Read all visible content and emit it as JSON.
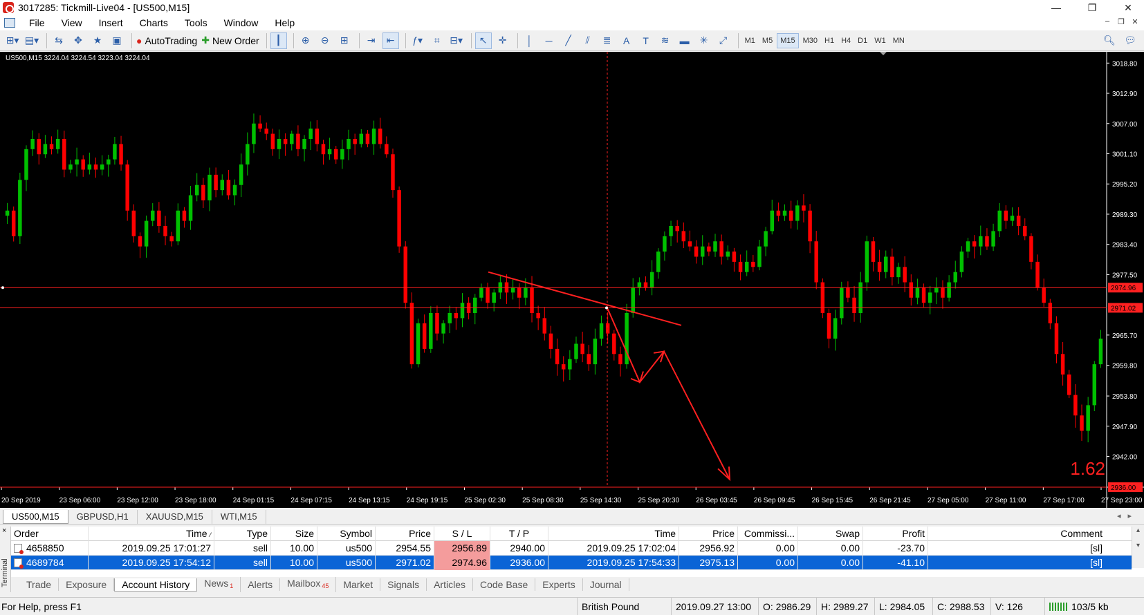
{
  "window": {
    "title": "3017285: Tickmill-Live04 - [US500,M15]",
    "controls": {
      "minimize": "—",
      "restore": "❐",
      "close": "✕"
    }
  },
  "menu": [
    "File",
    "View",
    "Insert",
    "Charts",
    "Tools",
    "Window",
    "Help"
  ],
  "toolbar": {
    "autotrading_label": "AutoTrading",
    "new_order_label": "New Order",
    "timeframes": [
      "M1",
      "M5",
      "M15",
      "M30",
      "H1",
      "H4",
      "D1",
      "W1",
      "MN"
    ],
    "active_timeframe": "M15"
  },
  "chart": {
    "info": "US500,M15  3224.04 3224.54 3223.04 3224.04",
    "ratio_label": "1.62",
    "background_color": "#000000",
    "up_color": "#00c000",
    "down_color": "#ff0000"
  },
  "chart_data": {
    "type": "candlestick",
    "symbol": "US500",
    "timeframe": "M15",
    "y_ticks": [
      "3018.80",
      "3012.90",
      "3007.00",
      "3001.10",
      "2995.20",
      "2989.30",
      "2983.40",
      "2977.50",
      "2965.70",
      "2959.80",
      "2953.80",
      "2947.90",
      "2942.00"
    ],
    "ylim": [
      2936.0,
      3021.0
    ],
    "x_ticks": [
      "20 Sep 2019",
      "23 Sep 06:00",
      "23 Sep 12:00",
      "23 Sep 18:00",
      "24 Sep 01:15",
      "24 Sep 07:15",
      "24 Sep 13:15",
      "24 Sep 19:15",
      "25 Sep 02:30",
      "25 Sep 08:30",
      "25 Sep 14:30",
      "25 Sep 20:30",
      "26 Sep 03:45",
      "26 Sep 09:45",
      "26 Sep 15:45",
      "26 Sep 21:45",
      "27 Sep 05:00",
      "27 Sep 11:00",
      "27 Sep 17:00",
      "27 Sep 23:00"
    ],
    "price_lines": [
      {
        "label": "2974.96",
        "value": 2974.96
      },
      {
        "label": "2971.02",
        "value": 2971.02
      },
      {
        "label": "2936.00",
        "value": 2936.0
      }
    ],
    "close_series": [
      2990,
      2985,
      2996,
      3002,
      3004,
      3001,
      3003,
      3002,
      3004,
      2998,
      2999,
      3000,
      2998,
      2999,
      2998,
      2999,
      3000,
      3003,
      2999,
      2990,
      2985,
      2983,
      2988,
      2990,
      2987,
      2985,
      2984,
      2990,
      2988,
      2993,
      2995,
      2992,
      2997,
      2994,
      2996,
      2993,
      2995,
      2999,
      3003,
      3007,
      3006,
      3005,
      3002,
      3004,
      3003,
      3005,
      3002,
      3004,
      3006,
      3003,
      3001,
      3002,
      3000,
      3002,
      3004,
      3003,
      3005,
      3003,
      3006,
      3003,
      3001,
      2994,
      2983,
      2972,
      2960,
      2968,
      2963,
      2970,
      2966,
      2968,
      2970,
      2969,
      2972,
      2970,
      2973,
      2975,
      2972,
      2974,
      2976,
      2974,
      2975,
      2973,
      2975,
      2970,
      2969,
      2966,
      2963,
      2960,
      2959,
      2961,
      2964,
      2962,
      2960,
      2965,
      2968,
      2966,
      2962,
      2960,
      2970,
      2975,
      2976,
      2975,
      2978,
      2982,
      2985,
      2987,
      2986,
      2984,
      2983,
      2981,
      2983,
      2982,
      2984,
      2981,
      2982,
      2980,
      2978,
      2980,
      2979,
      2983,
      2986,
      2990,
      2989,
      2990,
      2988,
      2991,
      2990,
      2984,
      2976,
      2970,
      2965,
      2969,
      2975,
      2973,
      2970,
      2976,
      2984,
      2980,
      2978,
      2981,
      2977,
      2979,
      2976,
      2973,
      2975,
      2972,
      2974,
      2975,
      2973,
      2976,
      2978,
      2982,
      2984,
      2983,
      2985,
      2983,
      2986,
      2990,
      2988,
      2989,
      2987,
      2985,
      2980,
      2975,
      2972,
      2968,
      2962,
      2958,
      2954,
      2950,
      2947,
      2952,
      2960,
      2965
    ]
  },
  "chart_tabs": [
    "US500,M15",
    "GBPUSD,H1",
    "XAUUSD,M15",
    "WTI,M15"
  ],
  "terminal": {
    "label": "Terminal",
    "close": "×",
    "columns": [
      "Order",
      "Time",
      "Type",
      "Size",
      "Symbol",
      "Price",
      "S / L",
      "T / P",
      "Time",
      "Price",
      "Commissi...",
      "Swap",
      "Profit",
      "Comment"
    ],
    "rows": [
      {
        "order": "4658850",
        "open_time": "2019.09.25 17:01:27",
        "type": "sell",
        "size": "10.00",
        "symbol": "us500",
        "price": "2954.55",
        "sl": "2956.89",
        "tp": "2940.00",
        "close_time": "2019.09.25 17:02:04",
        "close_price": "2956.92",
        "commission": "0.00",
        "swap": "0.00",
        "profit": "-23.70",
        "comment": "[sl]"
      },
      {
        "order": "4689784",
        "open_time": "2019.09.25 17:54:12",
        "type": "sell",
        "size": "10.00",
        "symbol": "us500",
        "price": "2971.02",
        "sl": "2974.96",
        "tp": "2936.00",
        "close_time": "2019.09.25 17:54:33",
        "close_price": "2975.13",
        "commission": "0.00",
        "swap": "0.00",
        "profit": "-41.10",
        "comment": "[sl]"
      }
    ],
    "tabs": [
      {
        "label": "Trade"
      },
      {
        "label": "Exposure"
      },
      {
        "label": "Account History"
      },
      {
        "label": "News",
        "badge": "1"
      },
      {
        "label": "Alerts"
      },
      {
        "label": "Mailbox",
        "badge": "45"
      },
      {
        "label": "Market"
      },
      {
        "label": "Signals"
      },
      {
        "label": "Articles"
      },
      {
        "label": "Code Base"
      },
      {
        "label": "Experts"
      },
      {
        "label": "Journal"
      }
    ],
    "active_tab": "Account History"
  },
  "status": {
    "help": "For Help, press F1",
    "profile": "British Pound",
    "datetime": "2019.09.27 13:00",
    "open": "O: 2986.29",
    "high": "H: 2989.27",
    "low": "L: 2984.05",
    "close": "C: 2988.53",
    "volume": "V: 126",
    "traffic": "103/5 kb"
  }
}
